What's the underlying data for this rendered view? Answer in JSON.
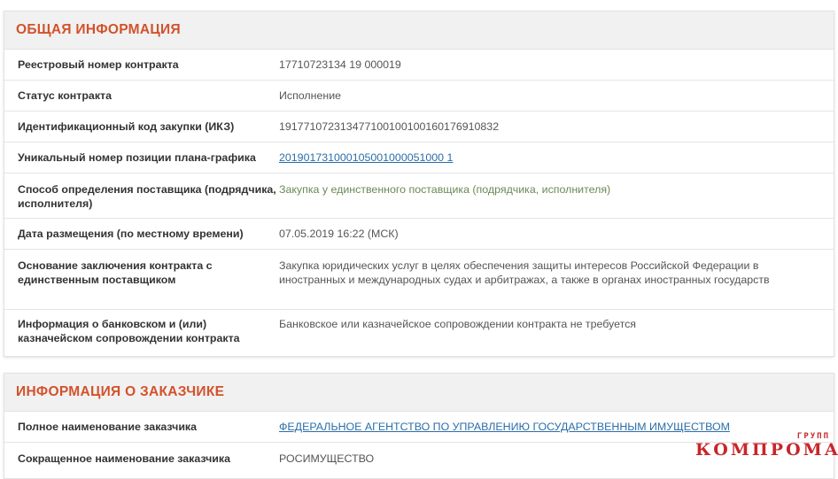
{
  "general": {
    "title": "ОБЩАЯ ИНФОРМАЦИЯ",
    "rows": [
      {
        "label": "Реестровый номер контракта",
        "value": "17710723134 19 000019"
      },
      {
        "label": "Статус контракта",
        "value": "Исполнение"
      },
      {
        "label": "Идентификационный код закупки (ИКЗ)",
        "value": "191771072313477100100100160176910832"
      },
      {
        "label": "Уникальный номер позиции плана-графика",
        "value": "201901731000105001000051000 1"
      },
      {
        "label": "Способ определения поставщика (подрядчика, исполнителя)",
        "value": "Закупка у единственного поставщика (подрядчика, исполнителя)"
      },
      {
        "label": "Дата размещения (по местному времени)",
        "value": "07.05.2019 16:22 (МСК)"
      },
      {
        "label": "Основание заключения контракта с единственным поставщиком",
        "value": "Закупка юридических услуг в целях обеспечения защиты интересов Российской Федерации в иностранных и международных судах и арбитражах, а также в органах иностранных государств"
      },
      {
        "label": "Информация о банковском и (или) казначейском сопровождении контракта",
        "value": "Банковское или казначейское сопровождении контракта не требуется"
      }
    ]
  },
  "customer": {
    "title": "ИНФОРМАЦИЯ О ЗАКАЗЧИКЕ",
    "rows": [
      {
        "label": "Полное наименование заказчика",
        "value": "ФЕДЕРАЛЬНОЕ АГЕНТСТВО ПО УПРАВЛЕНИЮ ГОСУДАРСТВЕННЫМ ИМУЩЕСТВОМ"
      },
      {
        "label": "Сокращенное наименование заказчика",
        "value": "РОСИМУЩЕСТВО"
      }
    ]
  },
  "watermark": {
    "small": "ГРУПП",
    "big": "КОМПРОМАТ"
  },
  "colors": {
    "accent": "#d2522b",
    "highlight": "#b8ff7a",
    "link": "#2b6ea8",
    "watermark": "#c7262a"
  }
}
